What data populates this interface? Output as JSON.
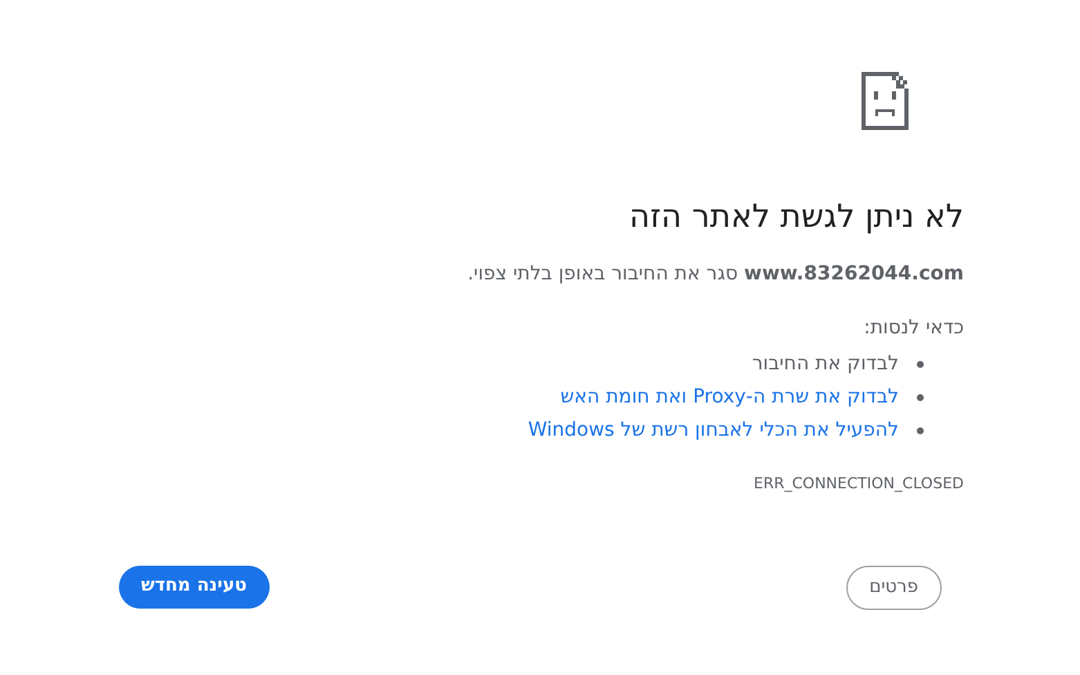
{
  "title": "לא ניתן לגשת לאתר הזה",
  "message": {
    "host": "www.83262044.com",
    "text": "סגר את החיבור באופן בלתי צפוי."
  },
  "suggestions_heading": "כדאי לנסות:",
  "suggestions": [
    {
      "kind": "text",
      "label": "לבדוק את החיבור"
    },
    {
      "kind": "link",
      "label": "לבדוק את שרת ה-Proxy ואת חומת האש"
    },
    {
      "kind": "link",
      "label": "להפעיל את הכלי לאבחון רשת של Windows"
    }
  ],
  "error_code": "ERR_CONNECTION_CLOSED",
  "buttons": {
    "details": "פרטים",
    "reload": "טעינה מחדש"
  }
}
